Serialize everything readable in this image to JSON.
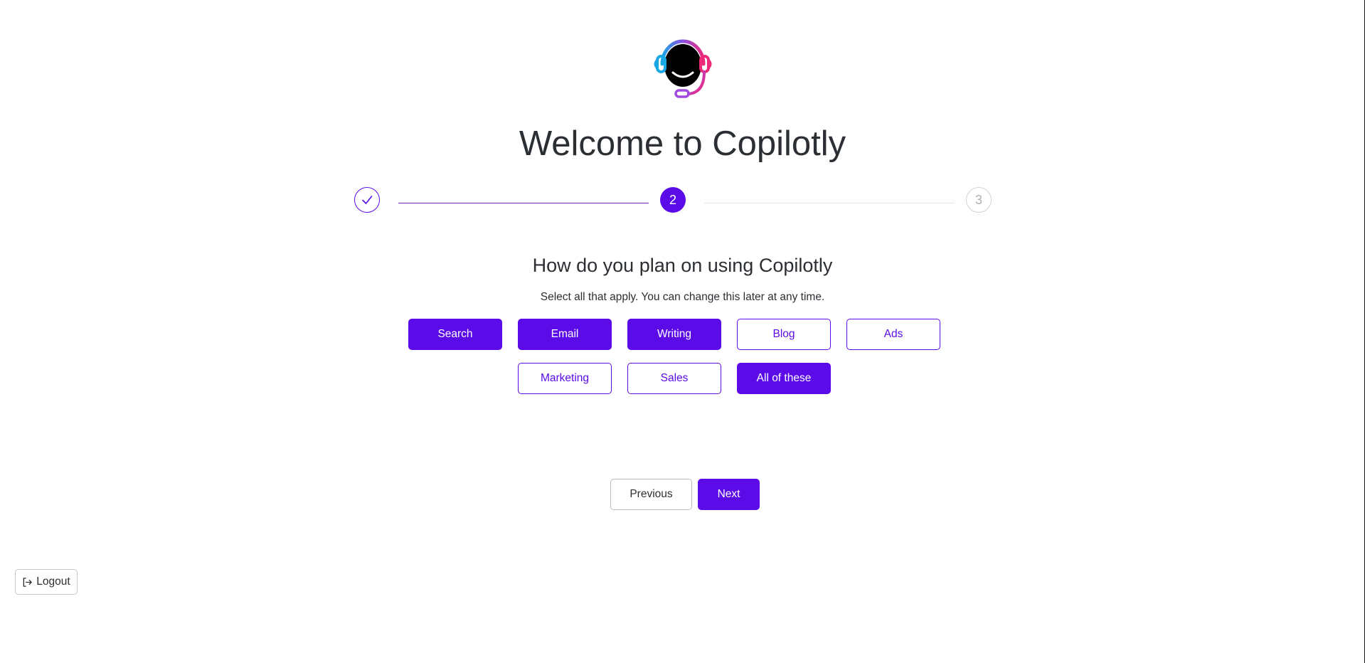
{
  "app": {
    "welcome_title": "Welcome to Copilotly",
    "logo_icon": "headset-smile-icon",
    "accent_color": "#5b0ae8"
  },
  "stepper": {
    "current_step": 2,
    "total_steps": 3,
    "steps": [
      {
        "label": "",
        "icon": "checkmark-icon",
        "status": "completed"
      },
      {
        "label": "2",
        "status": "active"
      },
      {
        "label": "3",
        "status": "upcoming"
      }
    ]
  },
  "main": {
    "question": "How do you plan on using Copilotly",
    "hint": "Select all that apply. You can change this later at any time.",
    "options": [
      {
        "label": "Search",
        "selected": true
      },
      {
        "label": "Email",
        "selected": true
      },
      {
        "label": "Writing",
        "selected": true
      },
      {
        "label": "Blog",
        "selected": false
      },
      {
        "label": "Ads",
        "selected": false
      },
      {
        "label": "Marketing",
        "selected": false
      },
      {
        "label": "Sales",
        "selected": false
      },
      {
        "label": "All of these",
        "selected": true
      }
    ]
  },
  "nav": {
    "previous_label": "Previous",
    "next_label": "Next"
  },
  "footer": {
    "logout_label": "Logout",
    "logout_icon": "logout-icon"
  }
}
